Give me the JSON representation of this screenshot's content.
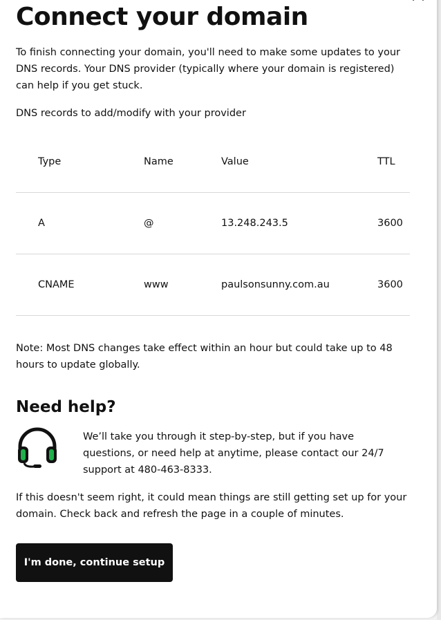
{
  "modal": {
    "title": "Connect your domain",
    "intro": "To finish connecting your domain, you'll need to make some updates to your DNS records. Your DNS provider (typically where your domain is registered) can help if you get stuck.",
    "records_label": "DNS records to add/modify with your provider",
    "table": {
      "headers": [
        "Type",
        "Name",
        "Value",
        "TTL"
      ],
      "rows": [
        [
          "A",
          "@",
          "13.248.243.5",
          "3600"
        ],
        [
          "CNAME",
          "www",
          "paulsonsunny.com.au",
          "3600"
        ]
      ]
    },
    "note": "Note: Most DNS changes take effect within an hour but could take up to 48 hours to update globally.",
    "help_title": "Need help?",
    "help_text": "We’ll take you through it step-by-step, but if you have questions, or need help at anytime, please contact our 24/7 support at 480-463-8333.",
    "status_text": "If this doesn't seem right, it could mean things are still getting set up for your domain. Check back and refresh the page in a couple of minutes.",
    "done_button": "I'm done, continue setup",
    "icons": {
      "close": "close-icon",
      "headset": "headset-icon"
    },
    "colors": {
      "button_bg": "#111111",
      "headset_accent": "#1fb04b"
    }
  }
}
